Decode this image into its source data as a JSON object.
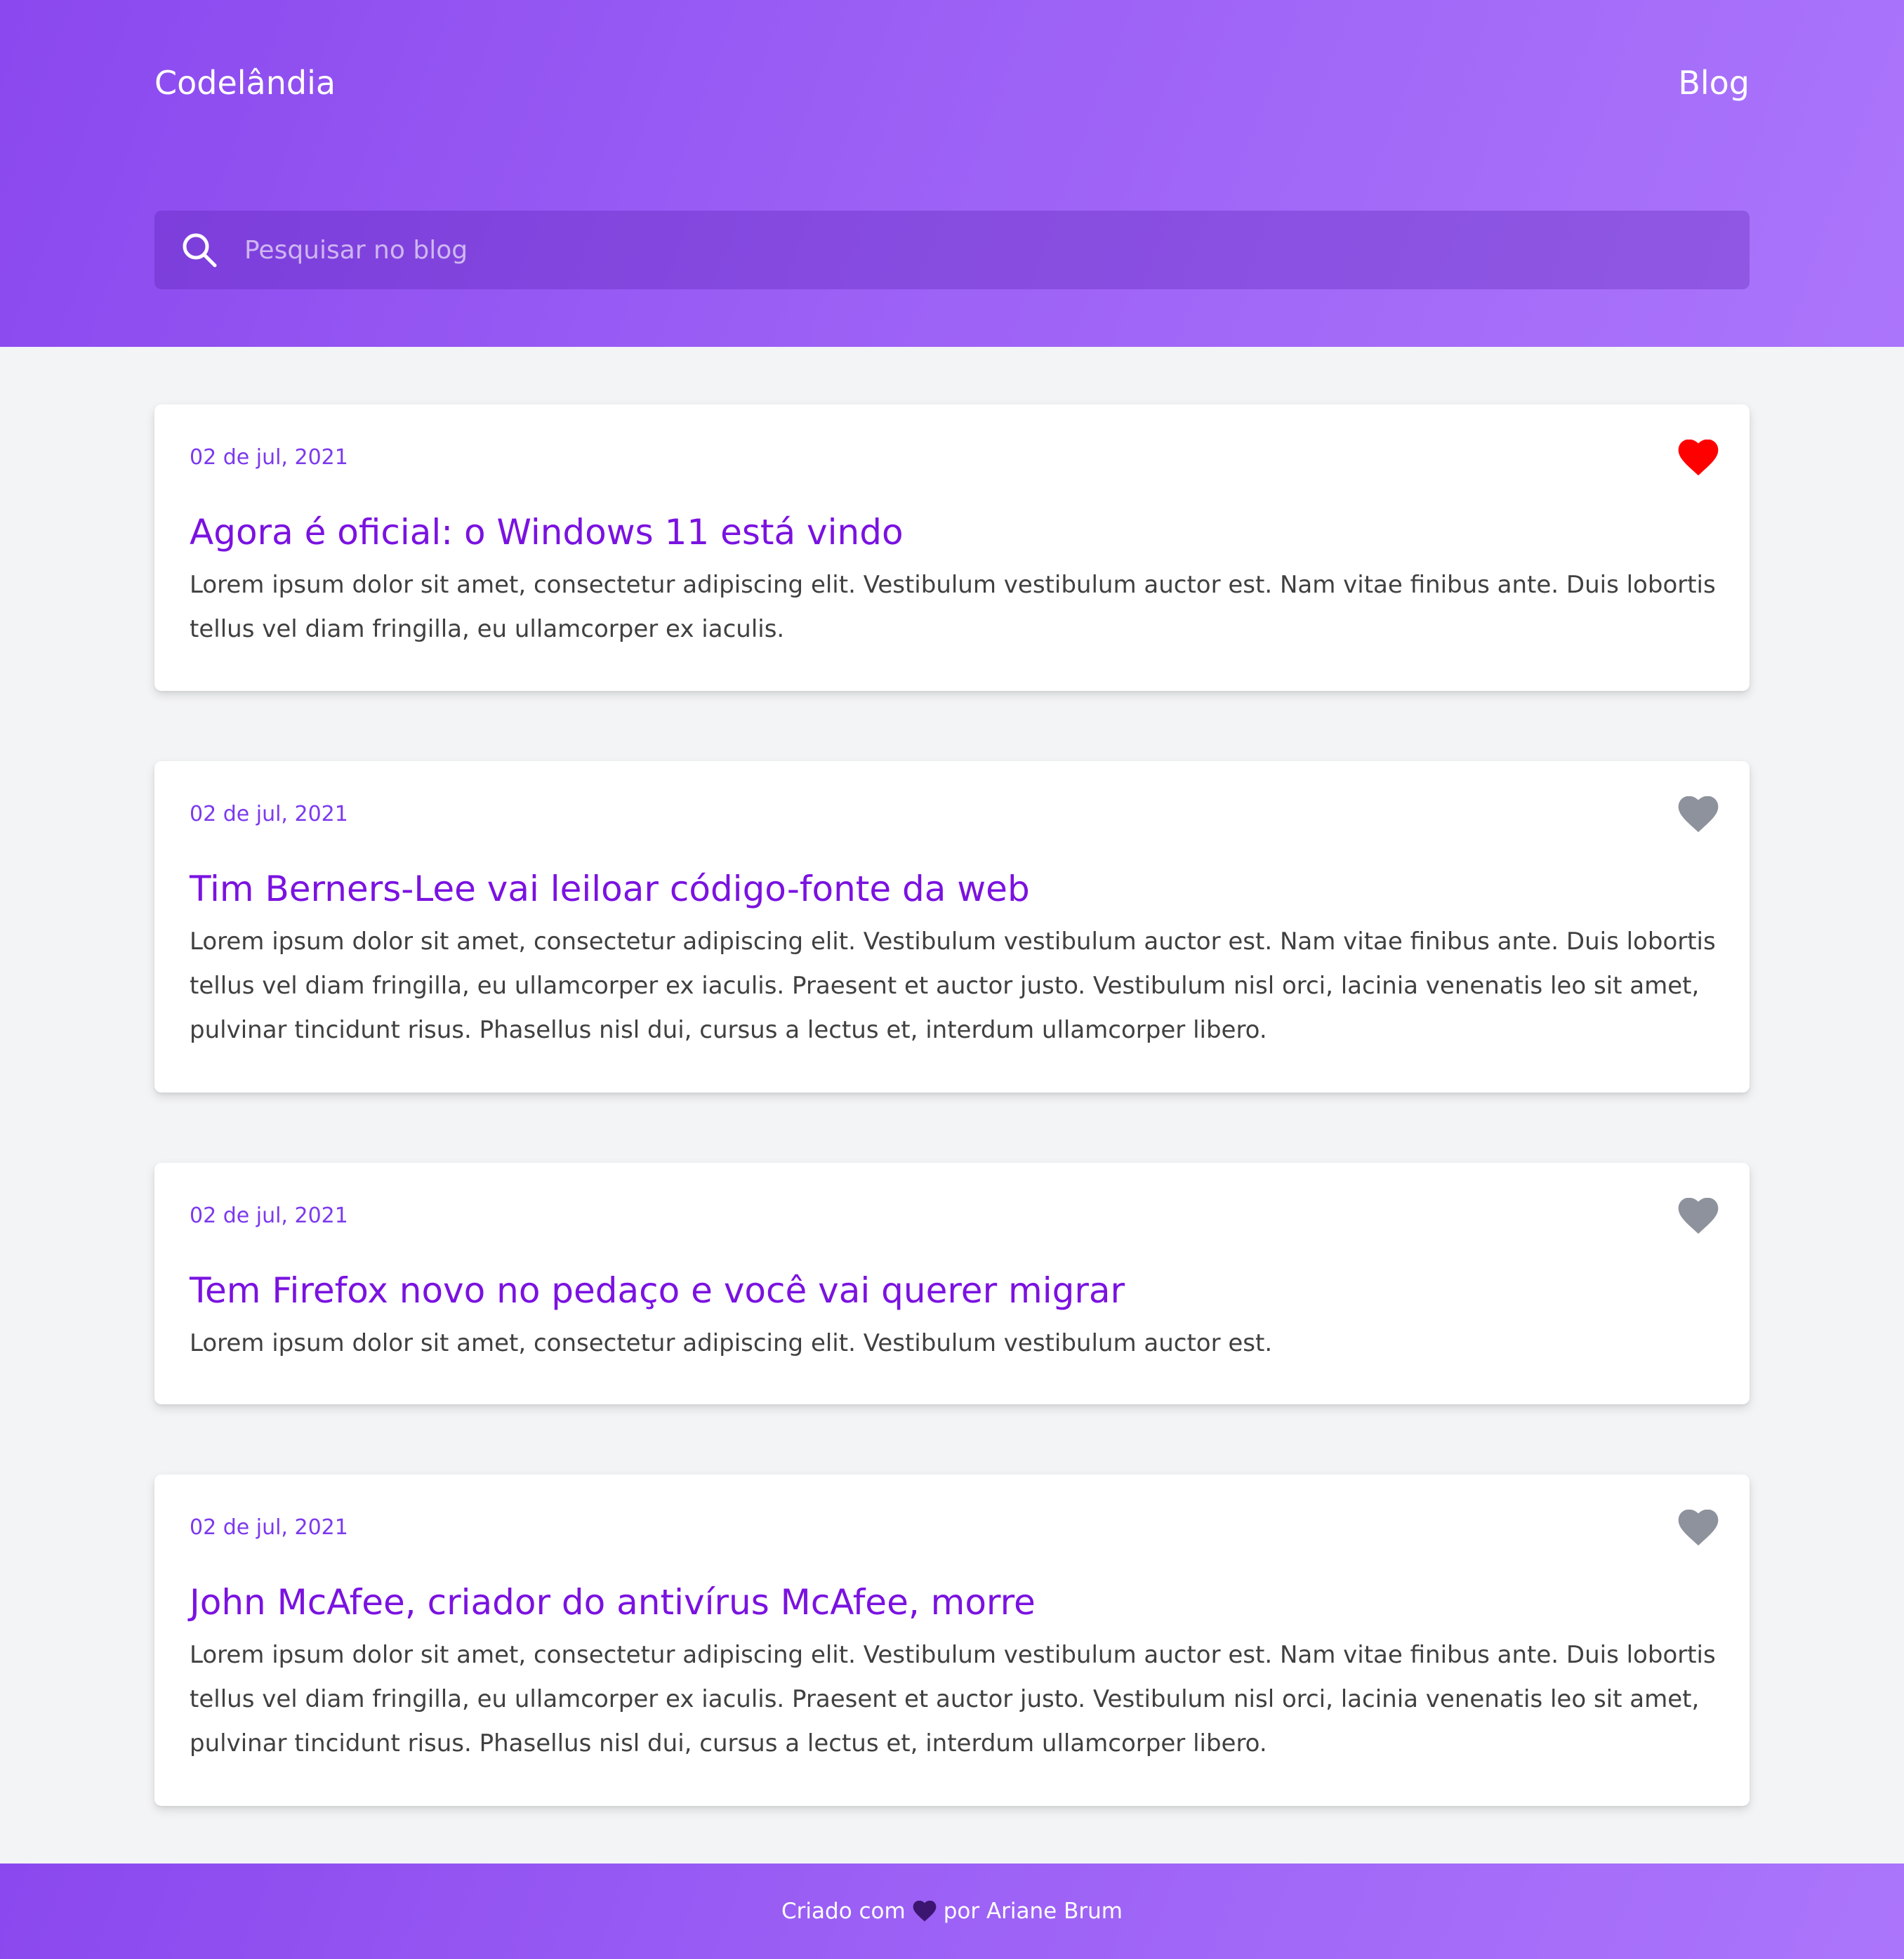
{
  "header": {
    "brand": "Codelândia",
    "nav_link": "Blog",
    "search_placeholder": "Pesquisar no blog",
    "search_value": ""
  },
  "posts": [
    {
      "date": "02 de jul, 2021",
      "title": "Agora é oficial: o Windows 11 está vindo",
      "excerpt": "Lorem ipsum dolor sit amet, consectetur adipiscing elit. Vestibulum vestibulum auctor est. Nam vitae finibus ante. Duis lobortis tellus vel diam fringilla, eu ullamcorper ex iaculis.",
      "liked": true
    },
    {
      "date": "02 de jul, 2021",
      "title": "Tim Berners-Lee vai leiloar código-fonte da web",
      "excerpt": "Lorem ipsum dolor sit amet, consectetur adipiscing elit. Vestibulum vestibulum auctor est. Nam vitae finibus ante. Duis lobortis tellus vel diam fringilla, eu ullamcorper ex iaculis. Praesent et auctor justo. Vestibulum nisl orci, lacinia venenatis leo sit amet, pulvinar tincidunt risus. Phasellus nisl dui, cursus a lectus et, interdum ullamcorper libero.",
      "liked": false
    },
    {
      "date": "02 de jul, 2021",
      "title": "Tem Firefox novo no pedaço e você vai querer migrar",
      "excerpt": "Lorem ipsum dolor sit amet, consectetur adipiscing elit. Vestibulum vestibulum auctor est.",
      "liked": false
    },
    {
      "date": "02 de jul, 2021",
      "title": "John McAfee, criador do antivírus McAfee, morre",
      "excerpt": "Lorem ipsum dolor sit amet, consectetur adipiscing elit. Vestibulum vestibulum auctor est. Nam vitae finibus ante. Duis lobortis tellus vel diam fringilla, eu ullamcorper ex iaculis. Praesent et auctor justo. Vestibulum nisl orci, lacinia venenatis leo sit amet, pulvinar tincidunt risus. Phasellus nisl dui, cursus a lectus et, interdum ullamcorper libero.",
      "liked": false
    }
  ],
  "footer": {
    "prefix": "Criado com",
    "heart_icon": "heart-icon",
    "suffix": "por Ariane Brum"
  },
  "colors": {
    "header_gradient_start": "#8a48ee",
    "header_gradient_end": "#ab75fb",
    "date": "#7c3aed",
    "title": "#7a12e0",
    "liked_heart": "#ff0000",
    "unliked_heart": "#8e929c",
    "footer_heart": "#3b1570"
  }
}
